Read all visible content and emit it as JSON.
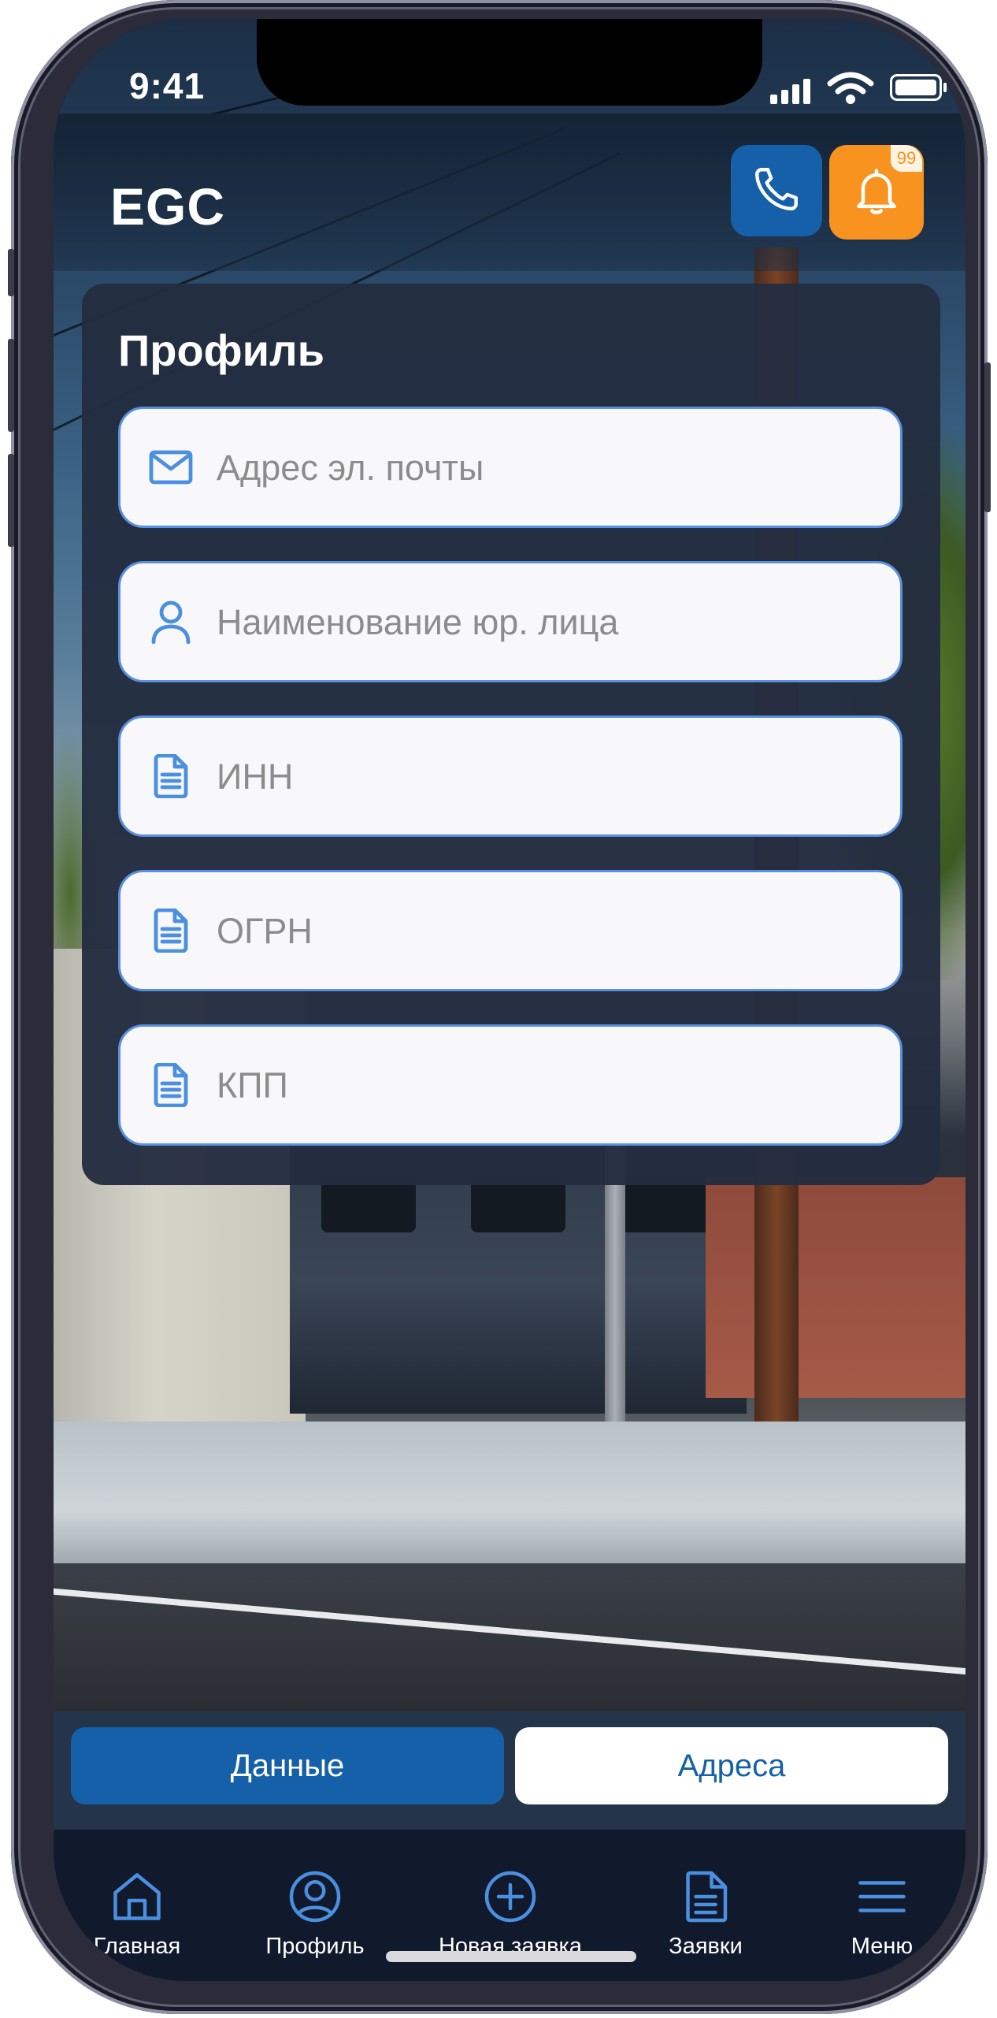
{
  "status_bar": {
    "time": "9:41"
  },
  "header": {
    "logo": "EGC",
    "phone_button_icon": "phone-icon",
    "notifications_button_icon": "bell-icon",
    "notifications_badge": "99"
  },
  "profile": {
    "title": "Профиль",
    "fields": [
      {
        "icon": "envelope-icon",
        "placeholder": "Адрес эл. почты",
        "value": ""
      },
      {
        "icon": "user-icon",
        "placeholder": "Наименование юр. лица",
        "value": ""
      },
      {
        "icon": "document-icon",
        "placeholder": "ИНН",
        "value": ""
      },
      {
        "icon": "document-icon",
        "placeholder": "ОГРН",
        "value": ""
      },
      {
        "icon": "document-icon",
        "placeholder": "КПП",
        "value": ""
      }
    ]
  },
  "segments": {
    "active": "Данные",
    "inactive": "Адреса"
  },
  "bottom_nav": [
    {
      "icon": "home-icon",
      "label": "Главная"
    },
    {
      "icon": "profile-icon",
      "label": "Профиль"
    },
    {
      "icon": "plus-circle-icon",
      "label": "Новая заявка"
    },
    {
      "icon": "document-icon",
      "label": "Заявки"
    },
    {
      "icon": "menu-icon",
      "label": "Меню"
    }
  ],
  "colors": {
    "brand_blue": "#1560a8",
    "accent_orange": "#f7931e",
    "icon_blue": "#4a8fe0",
    "card_bg": "#232d3f",
    "nav_bg": "#111a2c"
  }
}
